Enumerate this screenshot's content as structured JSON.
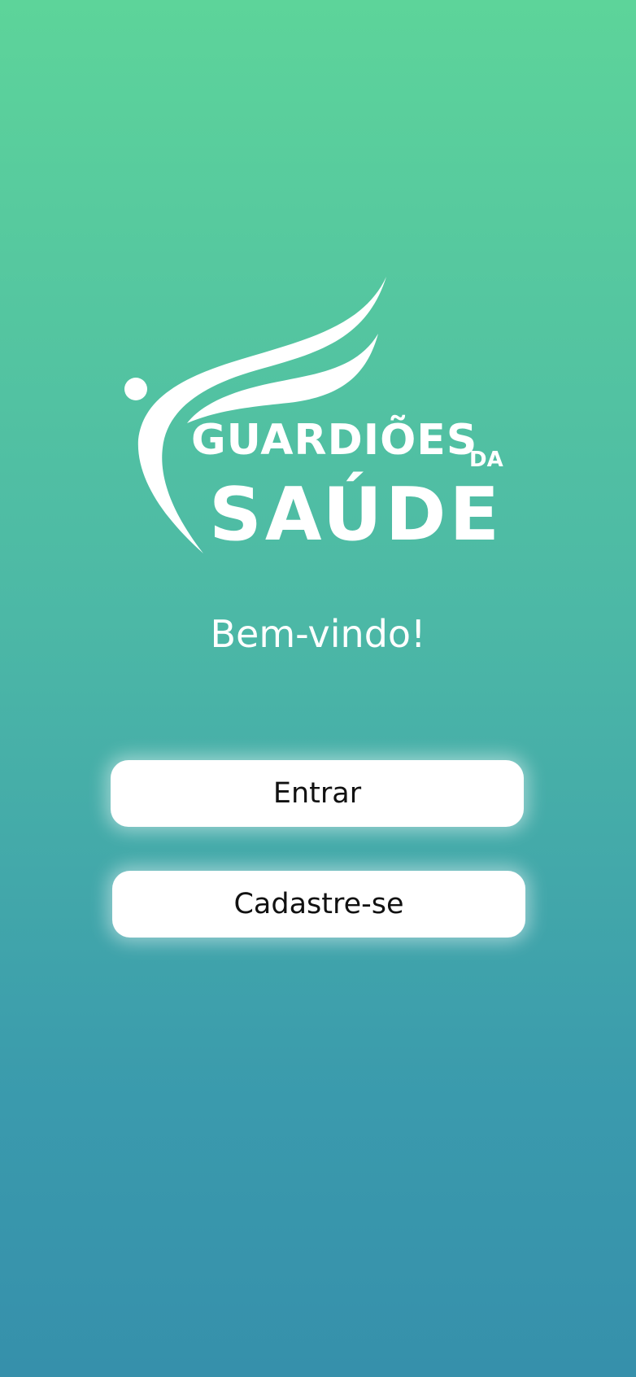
{
  "logo": {
    "line1": "GUARDIÕES",
    "line1_suffix": "DA",
    "line2": "SAÚDE"
  },
  "welcome": {
    "title": "Bem-vindo!"
  },
  "actions": {
    "login_label": "Entrar",
    "signup_label": "Cadastre-se"
  },
  "colors": {
    "gradient_top": "#5dd49a",
    "gradient_bottom": "#3690ab",
    "button_background": "#ffffff",
    "button_text": "#111111",
    "text": "#ffffff"
  }
}
